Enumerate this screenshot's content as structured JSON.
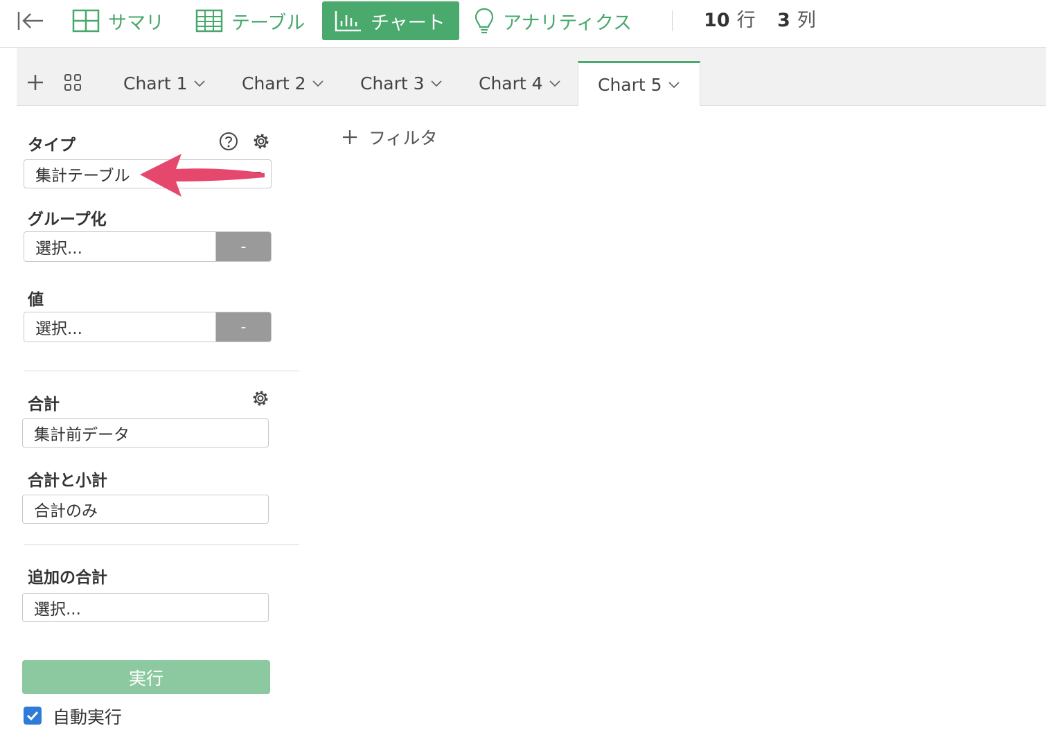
{
  "topbar": {
    "nav": [
      {
        "label": "サマリ",
        "icon": "summary-grid-icon"
      },
      {
        "label": "テーブル",
        "icon": "table-icon"
      },
      {
        "label": "チャート",
        "icon": "bar-chart-icon",
        "active": true
      },
      {
        "label": "アナリティクス",
        "icon": "lightbulb-icon"
      }
    ],
    "rows_count": "10",
    "rows_unit": "行",
    "cols_count": "3",
    "cols_unit": "列"
  },
  "tabs": [
    {
      "label": "Chart 1"
    },
    {
      "label": "Chart 2"
    },
    {
      "label": "Chart 3"
    },
    {
      "label": "Chart 4"
    },
    {
      "label": "Chart 5",
      "active": true
    }
  ],
  "panel": {
    "type_label": "タイプ",
    "type_value": "集計テーブル",
    "group_label": "グループ化",
    "group_placeholder": "選択...",
    "group_button": "-",
    "value_label": "値",
    "value_placeholder": "選択...",
    "value_button": "-",
    "total_label": "合計",
    "total_value": "集計前データ",
    "subtotal_label": "合計と小計",
    "subtotal_value": "合計のみ",
    "extra_label": "追加の合計",
    "extra_placeholder": "選択...",
    "run_label": "実行",
    "auto_run_label": "自動実行",
    "auto_run_checked": true
  },
  "main": {
    "filter_label": "フィルタ"
  },
  "colors": {
    "accent": "#4aa96c",
    "run_button": "#8dc9a0",
    "annotation_arrow": "#e5476d"
  }
}
